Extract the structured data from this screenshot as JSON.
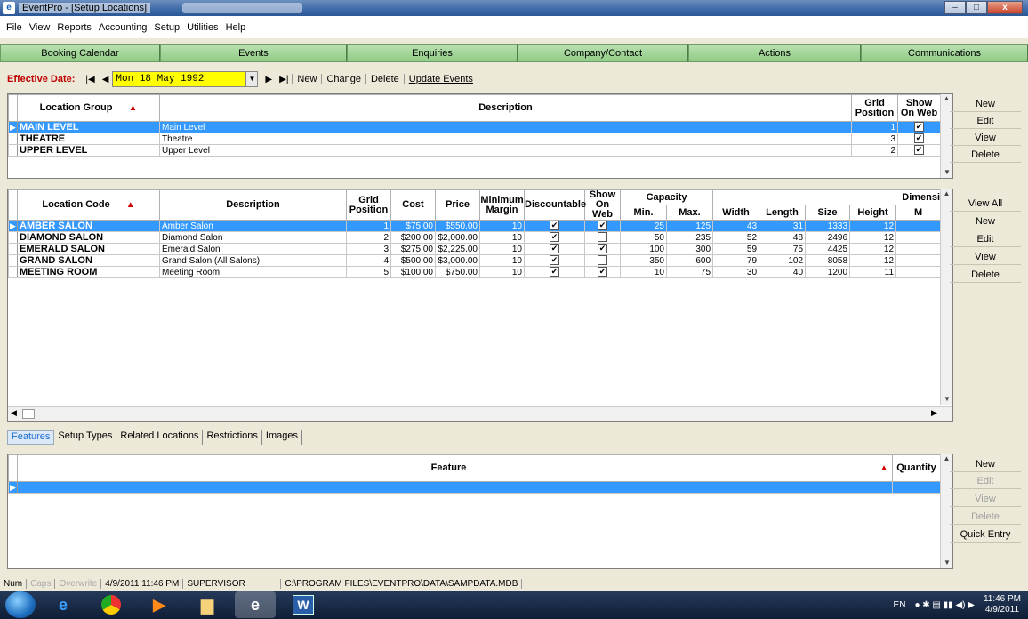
{
  "window": {
    "title": "EventPro - [Setup Locations]",
    "app_icon": "eventpro-icon",
    "controls": [
      "–",
      "□",
      "x"
    ]
  },
  "menu": [
    "File",
    "View",
    "Reports",
    "Accounting",
    "Setup",
    "Utilities",
    "Help"
  ],
  "nav": [
    "Booking Calendar",
    "Events",
    "Enquiries",
    "Company/Contact",
    "Actions",
    "Communications"
  ],
  "toolbar": {
    "effective_label": "Effective Date:",
    "date_value": "Mon 18 May 1992",
    "buttons": [
      "New",
      "Change",
      "Delete",
      "Update Events"
    ]
  },
  "groups": {
    "headers": {
      "group": "Location Group",
      "description": "Description",
      "grid_position": "Grid Position",
      "show_on_web": "Show On Web"
    },
    "rows": [
      {
        "group": "MAIN LEVEL",
        "description": "Main Level",
        "grid_position": "1",
        "show_on_web": true,
        "selected": true
      },
      {
        "group": "THEATRE",
        "description": "Theatre",
        "grid_position": "3",
        "show_on_web": true,
        "selected": false
      },
      {
        "group": "UPPER LEVEL",
        "description": "Upper Level",
        "grid_position": "2",
        "show_on_web": true,
        "selected": false
      }
    ],
    "side_buttons": [
      "New",
      "Edit",
      "View",
      "Delete"
    ]
  },
  "locations": {
    "headers": {
      "code": "Location Code",
      "description": "Description",
      "grid_position": "Grid Position",
      "cost": "Cost",
      "price": "Price",
      "min_margin": "Minimum Margin",
      "discountable": "Discountable",
      "show_on_web": "Show On Web",
      "capacity": "Capacity",
      "min": "Min.",
      "max": "Max.",
      "dimensions": "Dimensi",
      "width": "Width",
      "length": "Length",
      "size": "Size",
      "height": "Height",
      "m": "M"
    },
    "rows": [
      {
        "code": "AMBER SALON",
        "description": "Amber Salon",
        "grid": "1",
        "cost": "$75.00",
        "price": "$550.00",
        "margin": "10",
        "disc": true,
        "web": true,
        "min": "25",
        "max": "125",
        "width": "43",
        "length": "31",
        "size": "1333",
        "height": "12",
        "selected": true
      },
      {
        "code": "DIAMOND SALON",
        "description": "Diamond Salon",
        "grid": "2",
        "cost": "$200.00",
        "price": "$2,000.00",
        "margin": "10",
        "disc": true,
        "web": false,
        "min": "50",
        "max": "235",
        "width": "52",
        "length": "48",
        "size": "2496",
        "height": "12",
        "selected": false
      },
      {
        "code": "EMERALD SALON",
        "description": "Emerald Salon",
        "grid": "3",
        "cost": "$275.00",
        "price": "$2,225.00",
        "margin": "10",
        "disc": true,
        "web": true,
        "min": "100",
        "max": "300",
        "width": "59",
        "length": "75",
        "size": "4425",
        "height": "12",
        "selected": false
      },
      {
        "code": "GRAND SALON",
        "description": "Grand Salon (All Salons)",
        "grid": "4",
        "cost": "$500.00",
        "price": "$3,000.00",
        "margin": "10",
        "disc": true,
        "web": false,
        "min": "350",
        "max": "600",
        "width": "79",
        "length": "102",
        "size": "8058",
        "height": "12",
        "selected": false
      },
      {
        "code": "MEETING ROOM",
        "description": "Meeting Room",
        "grid": "5",
        "cost": "$100.00",
        "price": "$750.00",
        "margin": "10",
        "disc": true,
        "web": true,
        "min": "10",
        "max": "75",
        "width": "30",
        "length": "40",
        "size": "1200",
        "height": "11",
        "selected": false
      }
    ],
    "side_buttons": [
      "View All",
      "New",
      "Edit",
      "View",
      "Delete"
    ]
  },
  "tabs": [
    "Features",
    "Setup Types",
    "Related Locations",
    "Restrictions",
    "Images"
  ],
  "features": {
    "headers": {
      "feature": "Feature",
      "quantity": "Quantity"
    },
    "side_buttons": [
      "New",
      "Edit",
      "View",
      "Delete",
      "Quick Entry"
    ]
  },
  "status": {
    "num": "Num",
    "caps": "Caps",
    "overwrite": "Overwrite",
    "datetime": "4/9/2011 11:46 PM",
    "user": "SUPERVISOR",
    "path": "C:\\PROGRAM FILES\\EVENTPRO\\DATA\\SAMPDATA.MDB"
  },
  "taskbar": {
    "lang": "EN",
    "time": "11:46 PM",
    "date": "4/9/2011"
  },
  "colors": {
    "nav_green": "#8fcc85",
    "selection": "#3399ff",
    "date_yellow": "#ffff00",
    "label_red": "#c00000"
  }
}
